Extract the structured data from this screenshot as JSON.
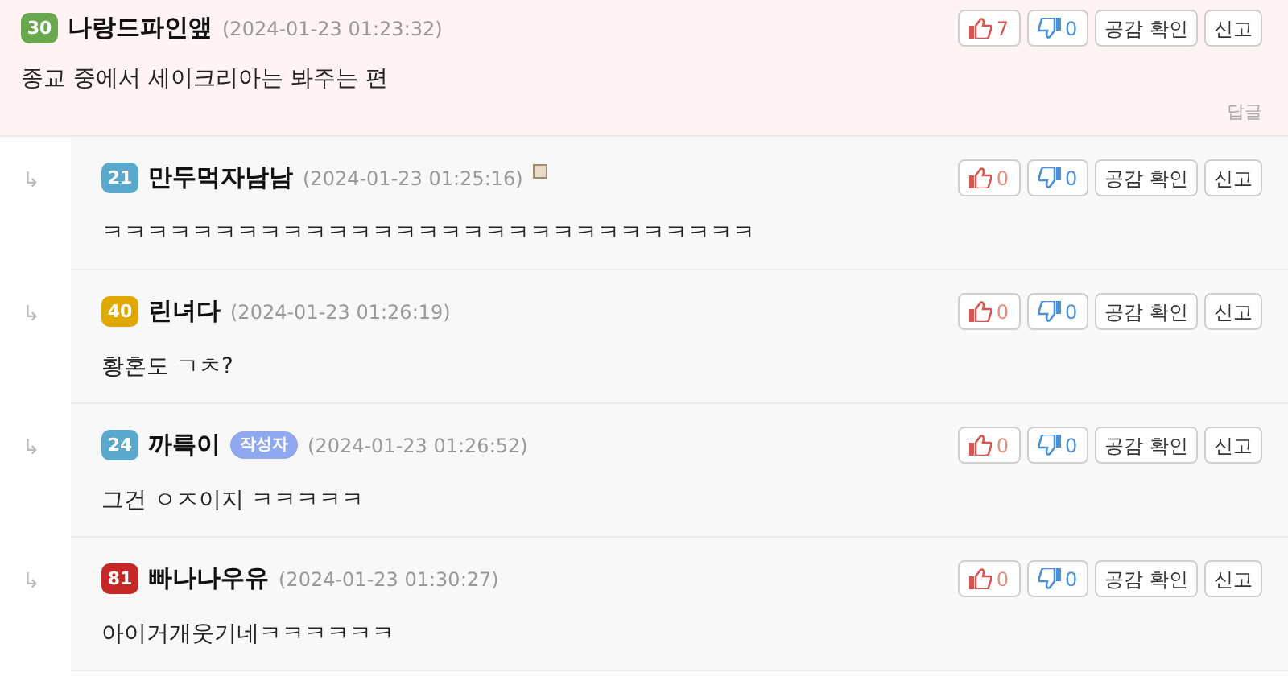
{
  "comment": {
    "badge": {
      "number": "30",
      "color": "#6aa84f"
    },
    "author": "나랑드파인앺",
    "time": "(2024-01-23 01:23:32)",
    "text": "종교 중에서 세이크리아는 봐주는 편",
    "likes": "7",
    "dislikes": "0",
    "buttons": [
      "공감 확인",
      "신고"
    ],
    "reply_link": "답글"
  },
  "replies": [
    {
      "arrow": "↳",
      "badge": {
        "number": "21",
        "color": "#5aa9cc"
      },
      "author": "만두먹자남남",
      "time": "(2024-01-23 01:25:16)",
      "broken_image": true,
      "text": "ㅋㅋㅋㅋㅋㅋㅋㅋㅋㅋㅋㅋㅋㅋㅋㅋㅋㅋㅋㅋㅋㅋㅋㅋㅋㅋㅋㅋㅋ",
      "likes": "0",
      "dislikes": "0",
      "buttons": [
        "공감 확인",
        "신고"
      ]
    },
    {
      "arrow": "↳",
      "badge": {
        "number": "40",
        "color": "#e0a800"
      },
      "author": "린녀다",
      "time": "(2024-01-23 01:26:19)",
      "text": "황혼도 ㄱㅊ?",
      "likes": "0",
      "dislikes": "0",
      "buttons": [
        "공감 확인",
        "신고"
      ]
    },
    {
      "arrow": "↳",
      "badge": {
        "number": "24",
        "color": "#5aa9cc"
      },
      "author": "까륵이",
      "author_tag": "작성자",
      "time": "(2024-01-23 01:26:52)",
      "text": "그건 ㅇㅈ이지 ㅋㅋㅋㅋㅋ",
      "likes": "0",
      "dislikes": "0",
      "buttons": [
        "공감 확인",
        "신고"
      ]
    },
    {
      "arrow": "↳",
      "badge": {
        "number": "81",
        "color": "#c62828"
      },
      "author": "빠나나우유",
      "time": "(2024-01-23 01:30:27)",
      "text": "아이거개웃기네ㅋㅋㅋㅋㅋㅋ",
      "likes": "0",
      "dislikes": "0",
      "buttons": [
        "공감 확인",
        "신고"
      ]
    }
  ]
}
